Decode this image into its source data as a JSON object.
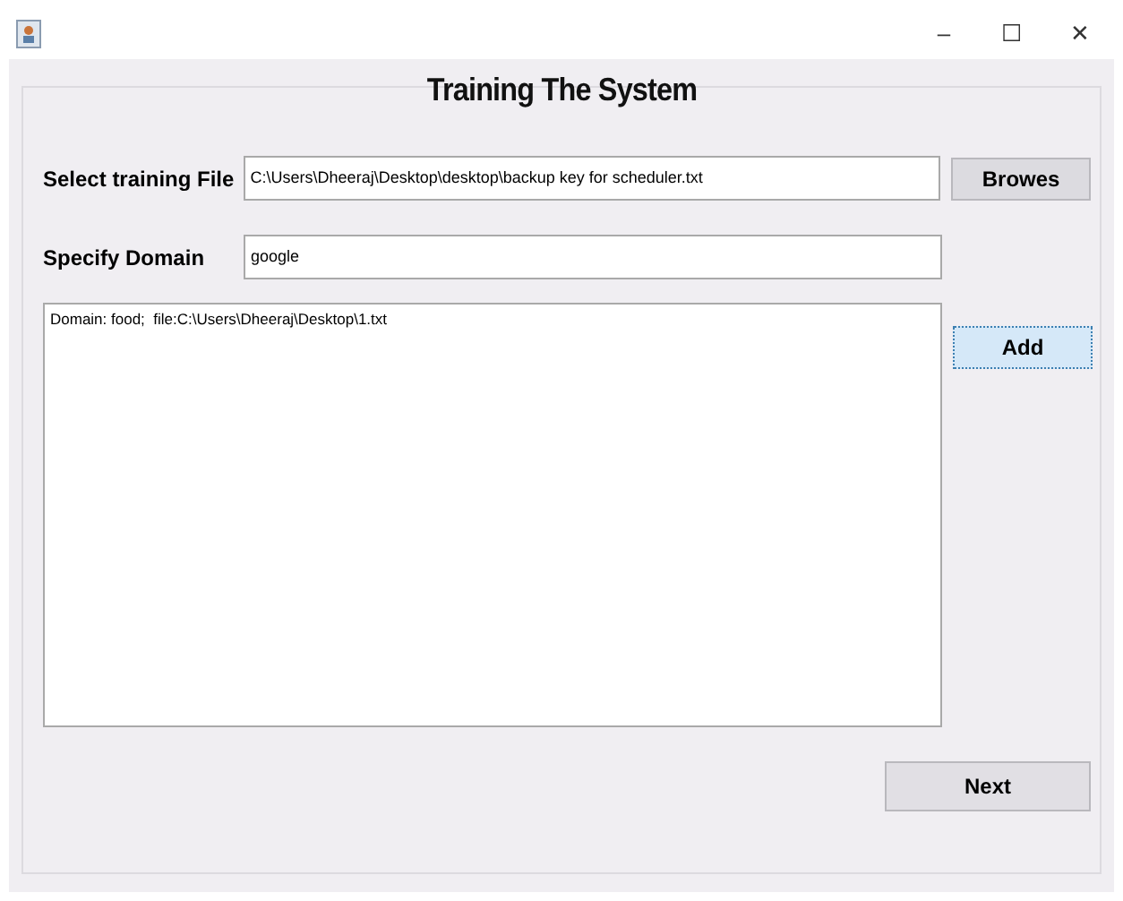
{
  "window": {
    "title_controls": [
      "–",
      "☐",
      "✕"
    ]
  },
  "heading": "Training The System",
  "file_row": {
    "label": "Select training File",
    "value": "C:\\Users\\Dheeraj\\Desktop\\desktop\\backup key for scheduler.txt",
    "button": "Browes"
  },
  "domain_row": {
    "label": "Specify Domain",
    "value": "google"
  },
  "log": {
    "lines": [
      "Domain: food;  file:C:\\Users\\Dheeraj\\Desktop\\1.txt"
    ]
  },
  "add_button": {
    "label": "Add",
    "focused": true
  },
  "next_button": {
    "label": "Next"
  }
}
